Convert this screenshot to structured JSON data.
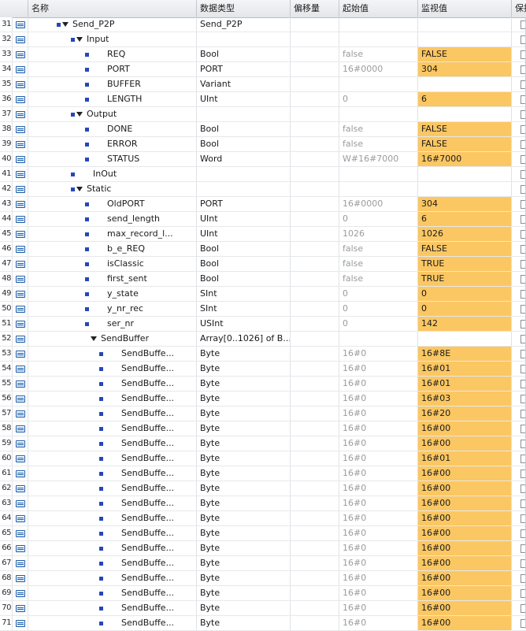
{
  "columns": {
    "name": "名称",
    "type": "数据类型",
    "offset": "偏移量",
    "start": "起始值",
    "monitor": "监视值",
    "retain": "保持"
  },
  "rows": [
    {
      "num": "31",
      "level": 0,
      "bullet": true,
      "expand": true,
      "name": "Send_P2P",
      "type": "Send_P2P",
      "start": "",
      "monitor": "",
      "on": false
    },
    {
      "num": "32",
      "level": 1,
      "bullet": true,
      "expand": true,
      "name": "Input",
      "type": "",
      "start": "",
      "monitor": "",
      "on": false
    },
    {
      "num": "33",
      "level": 2,
      "bullet": true,
      "expand": false,
      "name": "REQ",
      "type": "Bool",
      "start": "false",
      "monitor": "FALSE",
      "on": true
    },
    {
      "num": "34",
      "level": 2,
      "bullet": true,
      "expand": false,
      "name": "PORT",
      "type": "PORT",
      "start": "16#0000",
      "monitor": "304",
      "on": true
    },
    {
      "num": "35",
      "level": 2,
      "bullet": true,
      "expand": false,
      "name": "BUFFER",
      "type": "Variant",
      "start": "",
      "monitor": "",
      "on": false
    },
    {
      "num": "36",
      "level": 2,
      "bullet": true,
      "expand": false,
      "name": "LENGTH",
      "type": "UInt",
      "start": "0",
      "monitor": "6",
      "on": true
    },
    {
      "num": "37",
      "level": 1,
      "bullet": true,
      "expand": true,
      "name": "Output",
      "type": "",
      "start": "",
      "monitor": "",
      "on": false
    },
    {
      "num": "38",
      "level": 2,
      "bullet": true,
      "expand": false,
      "name": "DONE",
      "type": "Bool",
      "start": "false",
      "monitor": "FALSE",
      "on": true
    },
    {
      "num": "39",
      "level": 2,
      "bullet": true,
      "expand": false,
      "name": "ERROR",
      "type": "Bool",
      "start": "false",
      "monitor": "FALSE",
      "on": true
    },
    {
      "num": "40",
      "level": 2,
      "bullet": true,
      "expand": false,
      "name": "STATUS",
      "type": "Word",
      "start": "W#16#7000",
      "monitor": "16#7000",
      "on": true
    },
    {
      "num": "41",
      "level": 1,
      "bullet": true,
      "expand": false,
      "name": "InOut",
      "type": "",
      "start": "",
      "monitor": "",
      "on": false
    },
    {
      "num": "42",
      "level": 1,
      "bullet": true,
      "expand": true,
      "name": "Static",
      "type": "",
      "start": "",
      "monitor": "",
      "on": false
    },
    {
      "num": "43",
      "level": 2,
      "bullet": true,
      "expand": false,
      "name": "OldPORT",
      "type": "PORT",
      "start": "16#0000",
      "monitor": "304",
      "on": true
    },
    {
      "num": "44",
      "level": 2,
      "bullet": true,
      "expand": false,
      "name": "send_length",
      "type": "UInt",
      "start": "0",
      "monitor": "6",
      "on": true
    },
    {
      "num": "45",
      "level": 2,
      "bullet": true,
      "expand": false,
      "name": "max_record_l...",
      "type": "UInt",
      "start": "1026",
      "monitor": "1026",
      "on": true
    },
    {
      "num": "46",
      "level": 2,
      "bullet": true,
      "expand": false,
      "name": "b_e_REQ",
      "type": "Bool",
      "start": "false",
      "monitor": "FALSE",
      "on": true
    },
    {
      "num": "47",
      "level": 2,
      "bullet": true,
      "expand": false,
      "name": "isClassic",
      "type": "Bool",
      "start": "false",
      "monitor": "TRUE",
      "on": true
    },
    {
      "num": "48",
      "level": 2,
      "bullet": true,
      "expand": false,
      "name": "first_sent",
      "type": "Bool",
      "start": "false",
      "monitor": "TRUE",
      "on": true
    },
    {
      "num": "49",
      "level": 2,
      "bullet": true,
      "expand": false,
      "name": "y_state",
      "type": "SInt",
      "start": "0",
      "monitor": "0",
      "on": true
    },
    {
      "num": "50",
      "level": 2,
      "bullet": true,
      "expand": false,
      "name": "y_nr_rec",
      "type": "SInt",
      "start": "0",
      "monitor": "0",
      "on": true
    },
    {
      "num": "51",
      "level": 2,
      "bullet": true,
      "expand": false,
      "name": "ser_nr",
      "type": "USInt",
      "start": "0",
      "monitor": "142",
      "on": true
    },
    {
      "num": "52",
      "level": 2,
      "bullet": false,
      "expand": true,
      "name": "SendBuffer",
      "type": "Array[0..1026] of B...",
      "start": "",
      "monitor": "",
      "on": false
    },
    {
      "num": "53",
      "level": 3,
      "bullet": true,
      "expand": false,
      "name": "SendBuffe...",
      "type": "Byte",
      "start": "16#0",
      "monitor": "16#8E",
      "on": true
    },
    {
      "num": "54",
      "level": 3,
      "bullet": true,
      "expand": false,
      "name": "SendBuffe...",
      "type": "Byte",
      "start": "16#0",
      "monitor": "16#01",
      "on": true
    },
    {
      "num": "55",
      "level": 3,
      "bullet": true,
      "expand": false,
      "name": "SendBuffe...",
      "type": "Byte",
      "start": "16#0",
      "monitor": "16#01",
      "on": true
    },
    {
      "num": "56",
      "level": 3,
      "bullet": true,
      "expand": false,
      "name": "SendBuffe...",
      "type": "Byte",
      "start": "16#0",
      "monitor": "16#03",
      "on": true
    },
    {
      "num": "57",
      "level": 3,
      "bullet": true,
      "expand": false,
      "name": "SendBuffe...",
      "type": "Byte",
      "start": "16#0",
      "monitor": "16#20",
      "on": true
    },
    {
      "num": "58",
      "level": 3,
      "bullet": true,
      "expand": false,
      "name": "SendBuffe...",
      "type": "Byte",
      "start": "16#0",
      "monitor": "16#00",
      "on": true
    },
    {
      "num": "59",
      "level": 3,
      "bullet": true,
      "expand": false,
      "name": "SendBuffe...",
      "type": "Byte",
      "start": "16#0",
      "monitor": "16#00",
      "on": true
    },
    {
      "num": "60",
      "level": 3,
      "bullet": true,
      "expand": false,
      "name": "SendBuffe...",
      "type": "Byte",
      "start": "16#0",
      "monitor": "16#01",
      "on": true
    },
    {
      "num": "61",
      "level": 3,
      "bullet": true,
      "expand": false,
      "name": "SendBuffe...",
      "type": "Byte",
      "start": "16#0",
      "monitor": "16#00",
      "on": true
    },
    {
      "num": "62",
      "level": 3,
      "bullet": true,
      "expand": false,
      "name": "SendBuffe...",
      "type": "Byte",
      "start": "16#0",
      "monitor": "16#00",
      "on": true
    },
    {
      "num": "63",
      "level": 3,
      "bullet": true,
      "expand": false,
      "name": "SendBuffe...",
      "type": "Byte",
      "start": "16#0",
      "monitor": "16#00",
      "on": true
    },
    {
      "num": "64",
      "level": 3,
      "bullet": true,
      "expand": false,
      "name": "SendBuffe...",
      "type": "Byte",
      "start": "16#0",
      "monitor": "16#00",
      "on": true
    },
    {
      "num": "65",
      "level": 3,
      "bullet": true,
      "expand": false,
      "name": "SendBuffe...",
      "type": "Byte",
      "start": "16#0",
      "monitor": "16#00",
      "on": true
    },
    {
      "num": "66",
      "level": 3,
      "bullet": true,
      "expand": false,
      "name": "SendBuffe...",
      "type": "Byte",
      "start": "16#0",
      "monitor": "16#00",
      "on": true
    },
    {
      "num": "67",
      "level": 3,
      "bullet": true,
      "expand": false,
      "name": "SendBuffe...",
      "type": "Byte",
      "start": "16#0",
      "monitor": "16#00",
      "on": true
    },
    {
      "num": "68",
      "level": 3,
      "bullet": true,
      "expand": false,
      "name": "SendBuffe...",
      "type": "Byte",
      "start": "16#0",
      "monitor": "16#00",
      "on": true
    },
    {
      "num": "69",
      "level": 3,
      "bullet": true,
      "expand": false,
      "name": "SendBuffe...",
      "type": "Byte",
      "start": "16#0",
      "monitor": "16#00",
      "on": true
    },
    {
      "num": "70",
      "level": 3,
      "bullet": true,
      "expand": false,
      "name": "SendBuffe...",
      "type": "Byte",
      "start": "16#0",
      "monitor": "16#00",
      "on": true
    },
    {
      "num": "71",
      "level": 3,
      "bullet": true,
      "expand": false,
      "name": "SendBuffe...",
      "type": "Byte",
      "start": "16#0",
      "monitor": "16#00",
      "on": true
    }
  ]
}
